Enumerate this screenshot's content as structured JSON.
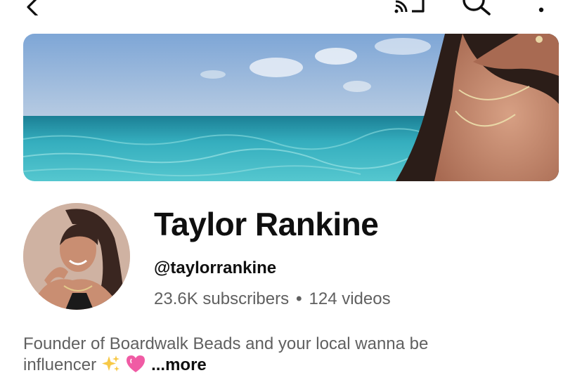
{
  "topbar": {
    "back_icon": "back-arrow-icon",
    "cast_icon": "cast-icon",
    "search_icon": "search-icon",
    "more_icon": "more-vertical-icon"
  },
  "channel": {
    "name": "Taylor Rankine",
    "handle": "@taylorrankine",
    "subscribers": "23.6K subscribers",
    "separator": "•",
    "videos": "124 videos",
    "description_line1": "Founder of Boardwalk Beads and your local wanna be",
    "description_line2": "influencer",
    "emoji_1": "sparkles-emoji",
    "emoji_2": "sparkling-heart-emoji",
    "more_label": "...more"
  },
  "colors": {
    "text_primary": "#0f0f0f",
    "text_secondary": "#606060",
    "sky": "#8fb6dc",
    "sea": "#29a3b5"
  }
}
